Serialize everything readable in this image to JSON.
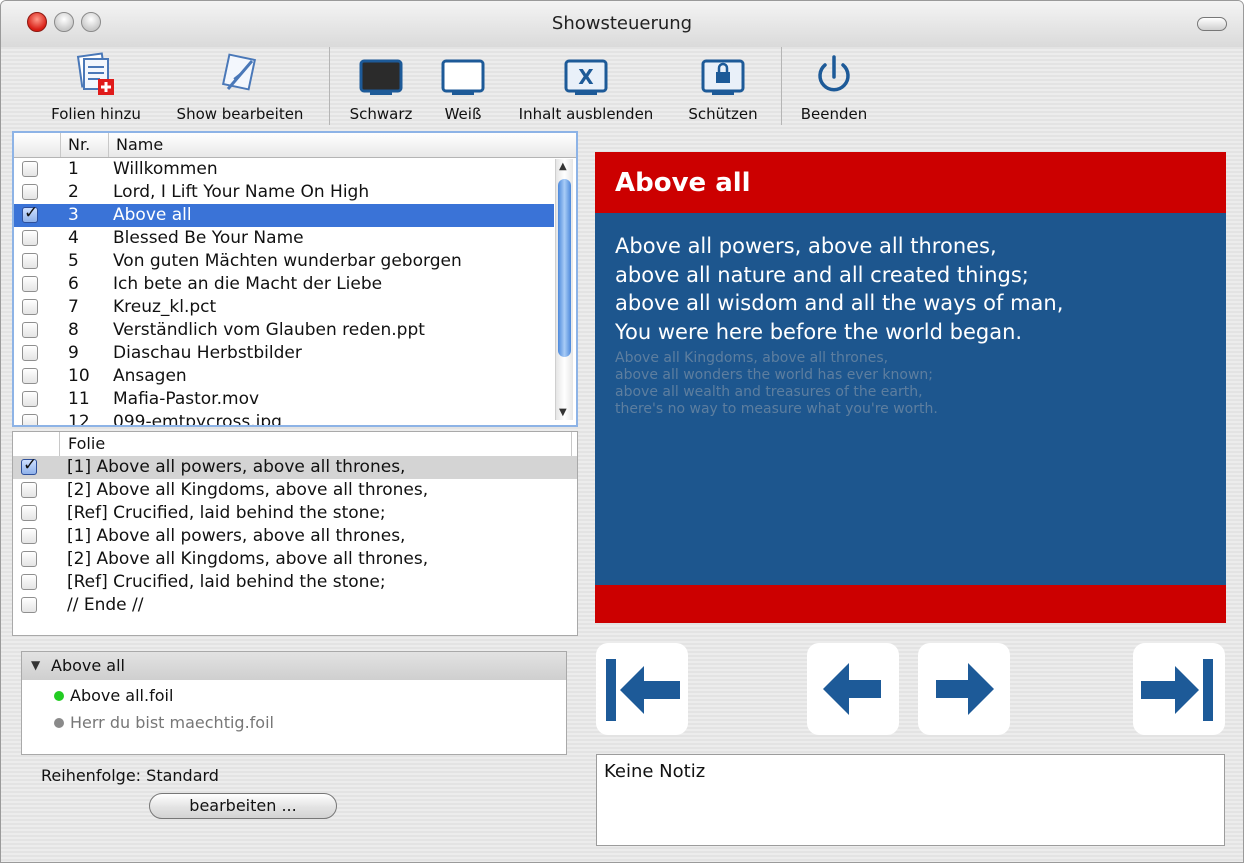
{
  "window": {
    "title": "Showsteuerung"
  },
  "toolbar": {
    "items": [
      {
        "label": "Folien hinzu",
        "icon": "add-slides-icon"
      },
      {
        "label": "Show bearbeiten",
        "icon": "edit-show-icon"
      },
      {
        "label": "Schwarz",
        "icon": "black-screen-icon"
      },
      {
        "label": "Weiß",
        "icon": "white-screen-icon"
      },
      {
        "label": "Inhalt ausblenden",
        "icon": "hide-content-icon"
      },
      {
        "label": "Schützen",
        "icon": "protect-icon"
      },
      {
        "label": "Beenden",
        "icon": "power-icon"
      }
    ]
  },
  "show_list": {
    "headers": {
      "nr": "Nr.",
      "name": "Name"
    },
    "rows": [
      {
        "nr": "1",
        "name": "Willkommen",
        "checked": false
      },
      {
        "nr": "2",
        "name": "Lord, I Lift Your Name On High",
        "checked": false
      },
      {
        "nr": "3",
        "name": "Above all",
        "checked": true,
        "selected": true
      },
      {
        "nr": "4",
        "name": "Blessed Be Your Name",
        "checked": false
      },
      {
        "nr": "5",
        "name": "Von guten Mächten wunderbar geborgen",
        "checked": false
      },
      {
        "nr": "6",
        "name": "Ich bete an die Macht der Liebe",
        "checked": false
      },
      {
        "nr": "7",
        "name": "Kreuz_kl.pct",
        "checked": false
      },
      {
        "nr": "8",
        "name": "Verständlich vom Glauben reden.ppt",
        "checked": false
      },
      {
        "nr": "9",
        "name": "Diaschau Herbstbilder",
        "checked": false
      },
      {
        "nr": "10",
        "name": "Ansagen",
        "checked": false
      },
      {
        "nr": "11",
        "name": "Mafia-Pastor.mov",
        "checked": false
      },
      {
        "nr": "12",
        "name": "099-emtpycross.jpg",
        "checked": false
      }
    ]
  },
  "slide_list": {
    "header": "Folie",
    "rows": [
      {
        "text": "[1] Above all powers, above all thrones,",
        "checked": true,
        "selected": true
      },
      {
        "text": "[2] Above all Kingdoms, above all thrones,",
        "checked": false
      },
      {
        "text": "[Ref] Crucified, laid behind the stone;",
        "checked": false
      },
      {
        "text": "[1] Above all powers, above all thrones,",
        "checked": false
      },
      {
        "text": "[2] Above all Kingdoms, above all thrones,",
        "checked": false
      },
      {
        "text": "[Ref] Crucified, laid behind the stone;",
        "checked": false
      },
      {
        "text": "// Ende //",
        "checked": false
      }
    ]
  },
  "foil_tree": {
    "group": "Above all",
    "items": [
      {
        "label": "Above all.foil",
        "status_color": "#22cc22"
      },
      {
        "label": "Herr du bist maechtig.foil",
        "status_color": "#8a8a8a"
      }
    ]
  },
  "order": {
    "label": "Reihenfolge: Standard",
    "button": "bearbeiten ..."
  },
  "preview": {
    "title": "Above all",
    "current_text": "Above all powers, above all thrones,\nabove all nature and all created things;\nabove all wisdom and all the ways of man,\nYou were here before the world began.",
    "next_text": "Above all Kingdoms, above all thrones,\nabove all wonders the world has ever known;\nabove all wealth and treasures of the earth,\nthere's no way to measure what you're worth.",
    "colors": {
      "title_bar": "#cc0000",
      "background": "#1d568e",
      "footer_bar": "#cc0000"
    }
  },
  "navigation": {
    "first": "first-slide-icon",
    "prev": "arrow-left-icon",
    "next": "arrow-right-icon",
    "last": "last-slide-icon",
    "color": "#1d5a98"
  },
  "notes": {
    "text": "Keine Notiz"
  }
}
